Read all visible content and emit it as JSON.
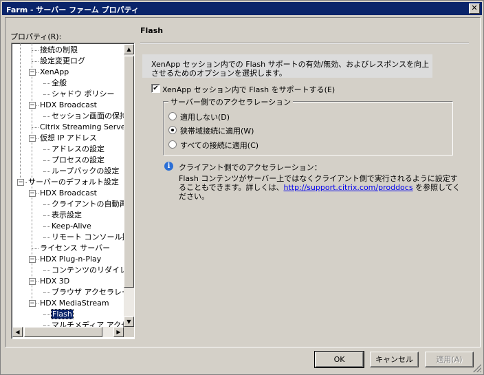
{
  "window": {
    "title": "Farm - サーバー ファーム プロパティ",
    "close_glyph": "✕"
  },
  "tree": {
    "label": "プロパティ(R):",
    "items": [
      {
        "label": "接続の制限"
      },
      {
        "label": "設定変更ログ"
      },
      {
        "label": "XenApp"
      },
      {
        "label": "全般"
      },
      {
        "label": "シャドウ ポリシー"
      },
      {
        "label": "HDX Broadcast"
      },
      {
        "label": "セッション画面の保持"
      },
      {
        "label": "Citrix Streaming Server"
      },
      {
        "label": "仮想 IP アドレス"
      },
      {
        "label": "アドレスの設定"
      },
      {
        "label": "プロセスの設定"
      },
      {
        "label": "ループバックの設定"
      },
      {
        "label": "サーバーのデフォルト設定"
      },
      {
        "label": "HDX Broadcast"
      },
      {
        "label": "クライアントの自動再接"
      },
      {
        "label": "表示設定"
      },
      {
        "label": "Keep-Alive"
      },
      {
        "label": "リモート コンソール接続"
      },
      {
        "label": "ライセンス サーバー"
      },
      {
        "label": "HDX Plug-n-Play"
      },
      {
        "label": "コンテンツのリダイレクト"
      },
      {
        "label": "HDX 3D"
      },
      {
        "label": "ブラウザ アクセラレーシ"
      },
      {
        "label": "HDX MediaStream"
      },
      {
        "label": "Flash"
      },
      {
        "label": "マルチメディア アクセラ"
      }
    ],
    "selected_index": 24
  },
  "pane": {
    "title": "Flash",
    "description": "XenApp セッション内での Flash サポートの有効/無効、およびレスポンスを向上させるためのオプションを選択します。",
    "enable_checkbox": {
      "label": "XenApp セッション内で Flash をサポートする(E)",
      "checked": true
    },
    "group_title": "サーバー側でのアクセラレーション",
    "options": [
      {
        "label": "適用しない(D)",
        "selected": false
      },
      {
        "label": "狭帯域接続に適用(W)",
        "selected": true
      },
      {
        "label": "すべての接続に適用(C)",
        "selected": false
      }
    ],
    "info_title": "クライアント側でのアクセラレーション：",
    "info_text_before": "Flash コンテンツがサーバー上ではなくクライアント側で実行されるように設定することもできます。詳しくは、",
    "info_link": "http://support.citrix.com/proddocs",
    "info_text_after": " を参照してください。"
  },
  "buttons": {
    "ok": "OK",
    "cancel": "キャンセル",
    "apply": "適用(A)"
  }
}
